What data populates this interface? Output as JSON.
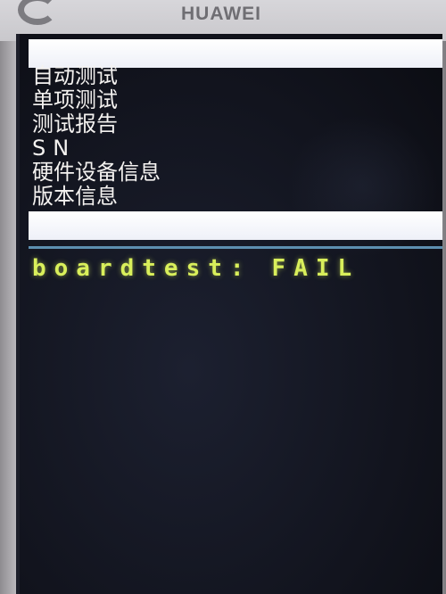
{
  "device": {
    "brand": "HUAWEI"
  },
  "menu": {
    "items": [
      {
        "label": "自动测试"
      },
      {
        "label": "单项测试"
      },
      {
        "label": "测试报告"
      },
      {
        "label": "SN"
      },
      {
        "label": "硬件设备信息"
      },
      {
        "label": "版本信息"
      }
    ]
  },
  "result": {
    "label": "boardtest:",
    "status": "FAIL"
  },
  "colors": {
    "screen_background": "#12141e",
    "menu_text": "#f4f2f0",
    "highlight_bar": "#ffffff",
    "result_text": "#d9ef5b",
    "divider": "#5d8fb0"
  }
}
